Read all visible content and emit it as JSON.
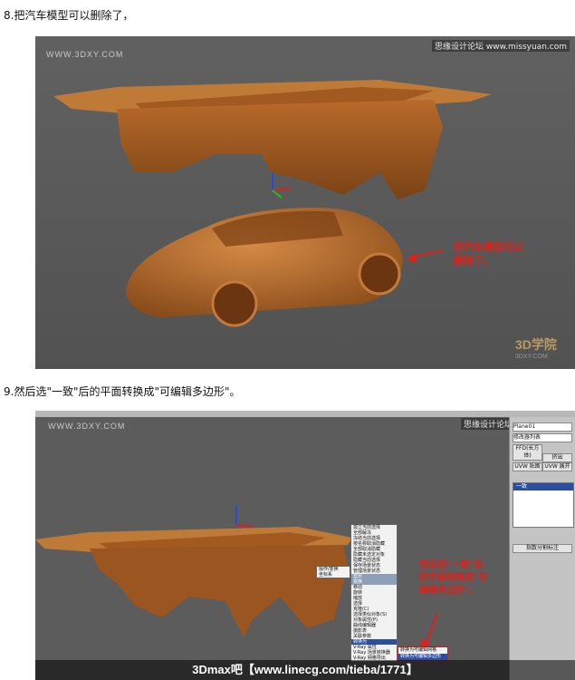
{
  "step8": {
    "caption": "8.把汽车模型可以删除了，",
    "watermark_left": "WWW.3DXY.COM",
    "watermark_right": "思缘设计论坛 www.missyuan.com",
    "note_lines": [
      "把汽车模型可以",
      "删除了。"
    ],
    "logo": "3D学院",
    "logo_sub": "3DXY.COM"
  },
  "step9": {
    "caption": "9.然后选\"一致\"后的平面转换成\"可编辑多边形\"。",
    "watermark_left": "WWW.3DXY.COM",
    "watermark_right": "思缘设计论坛",
    "note_lines": [
      "然后选\"一致\"后",
      "的平面转换成\"可",
      "编辑多边形\"。"
    ],
    "panel": {
      "object_name": "Plane01",
      "modifier_list": "修改器列表",
      "buttons": [
        "FFD(长方体)",
        "挤出",
        "UVW 贴图",
        "UVW 展开"
      ],
      "stack_item": "一致",
      "footer": "指数分割标注"
    },
    "quad_menu_left": [
      "操作/变换",
      "坐标系"
    ],
    "context_menu": {
      "top_items": [
        "孤立当前选择",
        "全部解冻",
        "冻结当前选择",
        "按名称取消隐藏",
        "全部取消隐藏",
        "隐藏未选定对象",
        "隐藏当前选择",
        "保存场景状态",
        "管理场景状态"
      ],
      "header_right": "显示",
      "header_left": "变换",
      "bottom_items": [
        "移动",
        "旋转",
        "缩放",
        "选择",
        "克隆(C)",
        "选择类似对象(S)",
        "对象属性(P)",
        "曲线编辑器",
        "摄影表",
        "关联参数",
        "转换为"
      ],
      "vray_items": [
        "V-Ray 属性",
        "V-Ray 场景转换器",
        "V-Ray 网格导出"
      ]
    },
    "submenu": [
      "转换为可编辑网格",
      "转换为可编辑多边形"
    ],
    "bottom_banner": "3Dmax吧【www.linecg.com/tieba/1771】"
  }
}
